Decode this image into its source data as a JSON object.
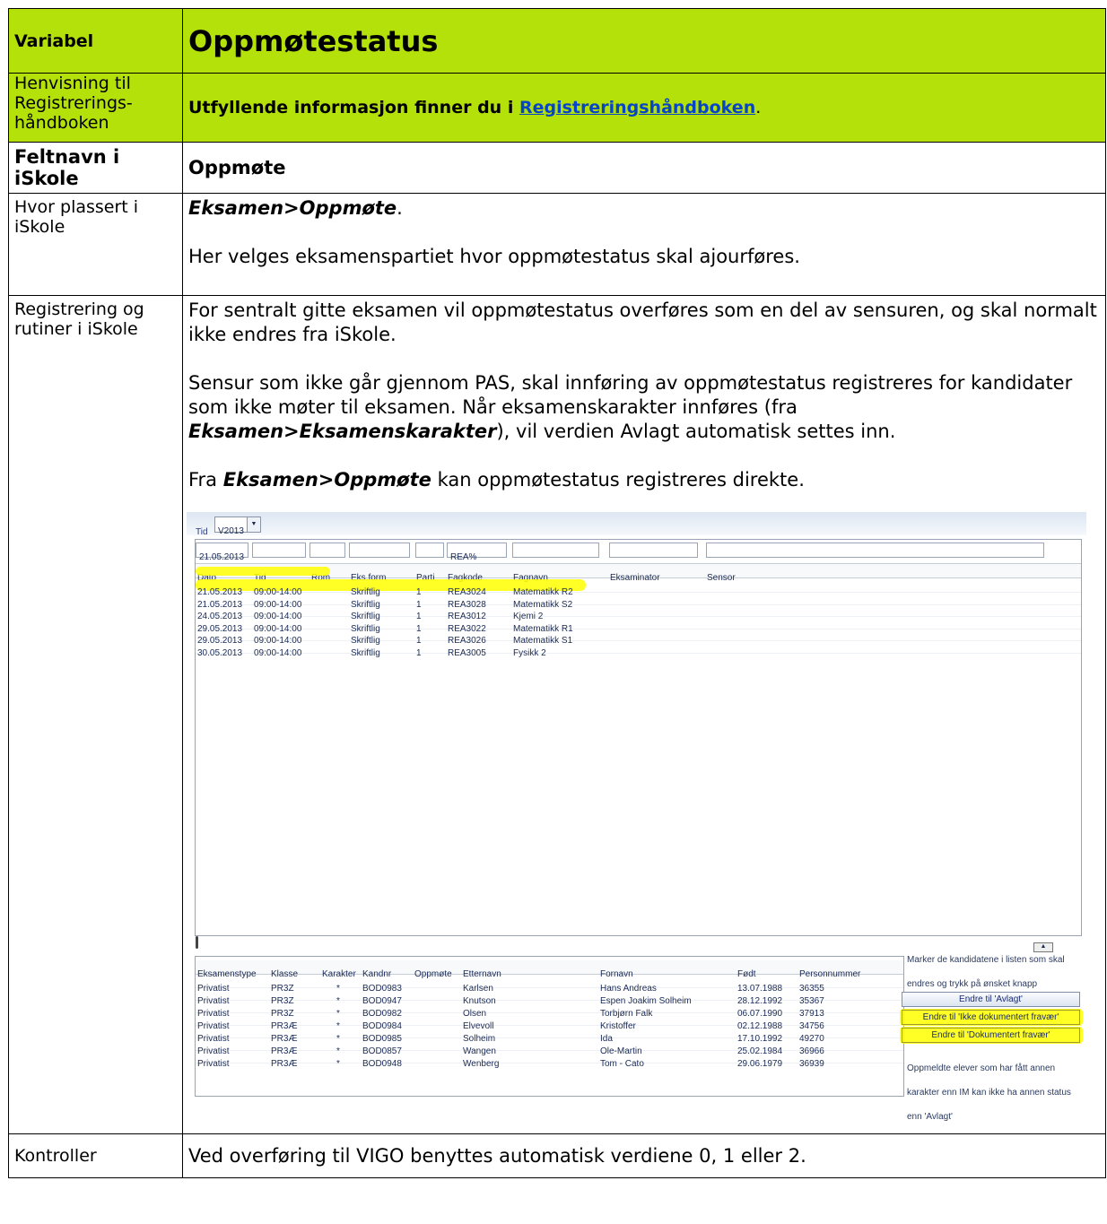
{
  "header": {
    "variable_label": "Variabel",
    "title": "Oppmøtestatus"
  },
  "reference": {
    "label": "Henvisning til Registrerings-håndboken",
    "text_before": "Utfyllende informasjon finner du i ",
    "link": "Registreringshåndboken",
    "text_after": "."
  },
  "field": {
    "label": "Feltnavn i iSkole",
    "value": "Oppmøte"
  },
  "location": {
    "label": "Hvor plassert i iSkole",
    "path": "Eksamen>Oppmøte",
    "path_suffix": ".",
    "text": "Her velges eksamenspartiet hvor oppmøtestatus skal ajourføres."
  },
  "registration": {
    "label": "Registrering og rutiner i iSkole",
    "p1": "For sentralt gitte eksamen vil oppmøtestatus overføres som en del av sensuren, og skal normalt ikke endres fra iSkole.",
    "p2a": "Sensur som ikke går gjennom PAS, skal innføring av oppmøtestatus registreres for kandidater som ikke møter til eksamen. Når eksamenskarakter innføres (fra ",
    "p2_path": "Eksamen>Eksamenskarakter",
    "p2b": "), vil verdien Avlagt automatisk settes inn.",
    "p3a": "Fra ",
    "p3_path": "Eksamen>Oppmøte",
    "p3b": " kan oppmøtestatus registreres direkte."
  },
  "screenshot": {
    "tid_label": "Tid",
    "tid_value": "V2013",
    "filters": {
      "dato": "21.05.2013",
      "fagkode": "REA%"
    },
    "columns": [
      "Dato",
      "Tid",
      "Rom",
      "Eks.form",
      "Parti",
      "Fagkode",
      "Fagnavn",
      "Eksaminator",
      "Sensor"
    ],
    "rows": [
      [
        "21.05.2013",
        "09:00-14:00",
        "",
        "Skriftlig",
        "1",
        "REA3024",
        "Matematikk R2",
        "",
        ""
      ],
      [
        "21.05.2013",
        "09:00-14:00",
        "",
        "Skriftlig",
        "1",
        "REA3028",
        "Matematikk S2",
        "",
        ""
      ],
      [
        "24.05.2013",
        "09:00-14:00",
        "",
        "Skriftlig",
        "1",
        "REA3012",
        "Kjemi 2",
        "",
        ""
      ],
      [
        "29.05.2013",
        "09:00-14:00",
        "",
        "Skriftlig",
        "1",
        "REA3022",
        "Matematikk R1",
        "",
        ""
      ],
      [
        "29.05.2013",
        "09:00-14:00",
        "",
        "Skriftlig",
        "1",
        "REA3026",
        "Matematikk S1",
        "",
        ""
      ],
      [
        "30.05.2013",
        "09:00-14:00",
        "",
        "Skriftlig",
        "1",
        "REA3005",
        "Fysikk 2",
        "",
        ""
      ]
    ],
    "columns2": [
      "Eksamenstype",
      "Klasse",
      "Karakter",
      "Kandnr",
      "Oppmøte",
      "Etternavn",
      "Fornavn",
      "Født",
      "Personnummer"
    ],
    "rows2": [
      [
        "Privatist",
        "PR3Z",
        "*",
        "BOD0983",
        "",
        "Karlsen",
        "Hans Andreas",
        "13.07.1988",
        "36355"
      ],
      [
        "Privatist",
        "PR3Z",
        "*",
        "BOD0947",
        "",
        "Knutson",
        "Espen Joakim Solheim",
        "28.12.1992",
        "35367"
      ],
      [
        "Privatist",
        "PR3Z",
        "*",
        "BOD0982",
        "",
        "Olsen",
        "Torbjørn Falk",
        "06.07.1990",
        "37913"
      ],
      [
        "Privatist",
        "PR3Æ",
        "*",
        "BOD0984",
        "",
        "Elvevoll",
        "Kristoffer",
        "02.12.1988",
        "34756"
      ],
      [
        "Privatist",
        "PR3Æ",
        "*",
        "BOD0985",
        "",
        "Solheim",
        "Ida",
        "17.10.1992",
        "49270"
      ],
      [
        "Privatist",
        "PR3Æ",
        "*",
        "BOD0857",
        "",
        "Wangen",
        "Ole-Martin",
        "25.02.1984",
        "36966"
      ],
      [
        "Privatist",
        "PR3Æ",
        "*",
        "BOD0948",
        "",
        "Wenberg",
        "Tom - Cato",
        "29.06.1979",
        "36939"
      ]
    ],
    "side_info": "Marker de kandidatene i listen som skal endres og trykk på ønsket knapp",
    "buttons": [
      "Endre til 'Avlagt'",
      "Endre til 'Ikke dokumentert fravær'",
      "Endre til 'Dokumentert fravær'"
    ],
    "side_note": "Oppmeldte elever som har fått annen karakter enn IM kan ikke ha annen status enn 'Avlagt'",
    "highlight_color": "#ffff00"
  },
  "controls": {
    "label": "Kontroller",
    "text": "Ved overføring til VIGO benyttes automatisk verdiene 0, 1 eller 2."
  }
}
